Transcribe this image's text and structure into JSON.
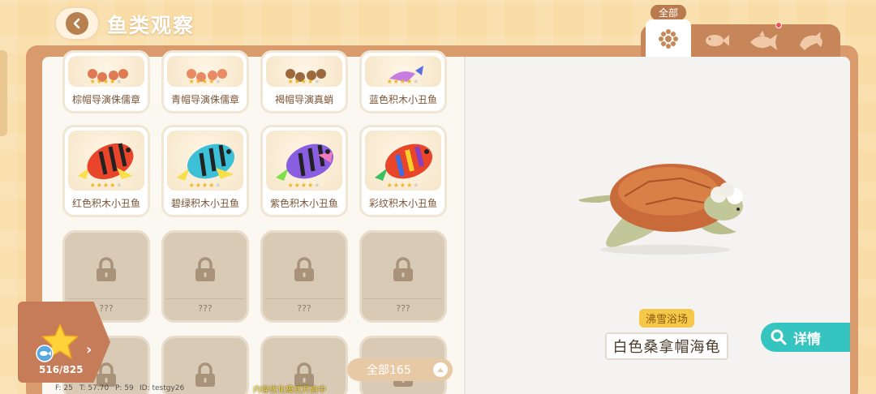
{
  "header": {
    "title": "鱼类观察",
    "back_icon": "chevron-left-icon"
  },
  "tabs": {
    "badge_label": "全部",
    "items": [
      {
        "name": "all",
        "icon": "flower-grid-icon",
        "active": true
      },
      {
        "name": "small-fish",
        "icon": "fish-icon",
        "active": false
      },
      {
        "name": "medium-fish",
        "icon": "big-fish-icon",
        "active": false,
        "has_notification": true
      },
      {
        "name": "large-fish",
        "icon": "dolphin-icon",
        "active": false
      }
    ]
  },
  "grid": {
    "row1": [
      {
        "name": "棕帽导演侏儒章",
        "stars": 4
      },
      {
        "name": "青帽导演侏儒章",
        "stars": 4
      },
      {
        "name": "褐帽导演真蛸",
        "stars": 4
      },
      {
        "name": "蓝色积木小丑鱼",
        "stars": 4
      }
    ],
    "row2": [
      {
        "name": "红色积木小丑鱼",
        "stars": 4
      },
      {
        "name": "碧绿积木小丑鱼",
        "stars": 4
      },
      {
        "name": "紫色积木小丑鱼",
        "stars": 4
      },
      {
        "name": "彩纹积木小丑鱼",
        "stars": 4
      }
    ],
    "locked_label": "???"
  },
  "collection": {
    "count": "516/825",
    "arrow": "›"
  },
  "filter": {
    "label": "全部165"
  },
  "debug": {
    "fps": "F: 25",
    "time": "T: 57.70",
    "ping": "P: 59",
    "id": "ID: testgy26",
    "memory_mode": "内存优化模式开启中"
  },
  "detail": {
    "location": "沸雪浴场",
    "species_name": "白色桑拿帽海龟",
    "detail_button": "详情"
  },
  "colors": {
    "accent_teal": "#35c4c0",
    "frame_brown": "#d99a6c",
    "star_yellow": "#f2b320"
  }
}
